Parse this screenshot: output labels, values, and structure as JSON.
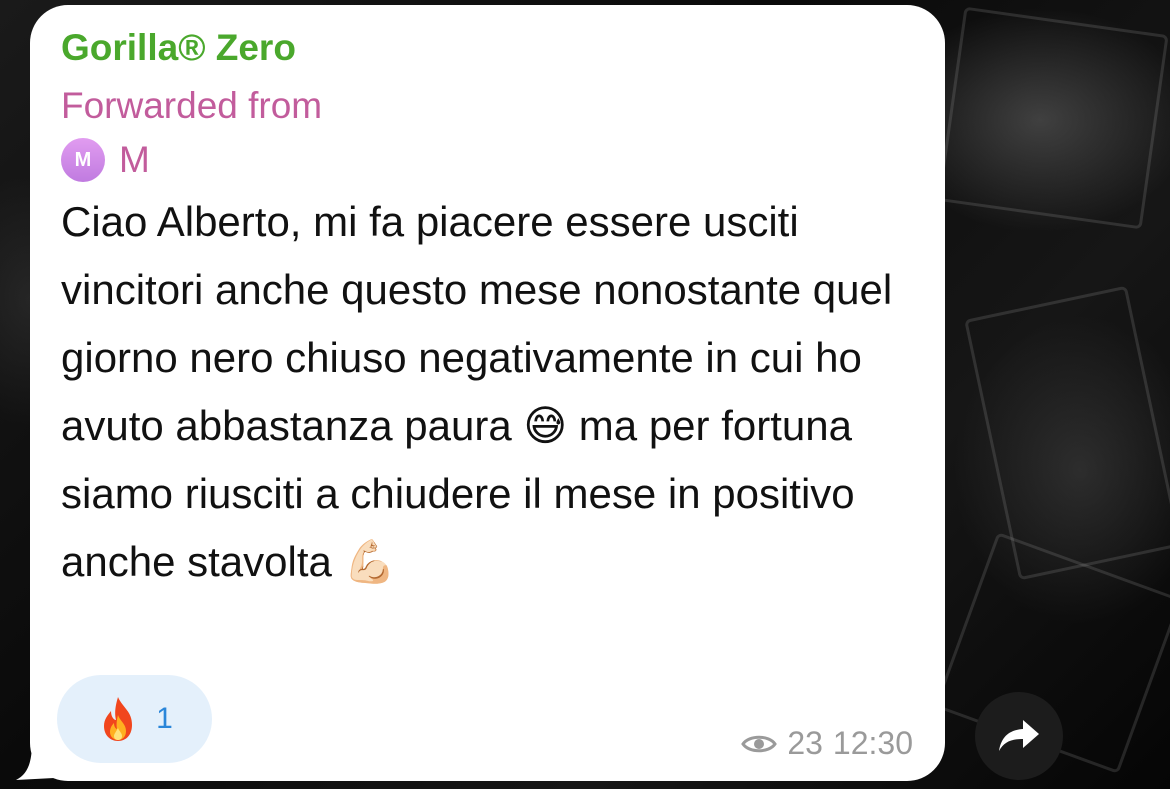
{
  "message": {
    "sender": "Gorilla® Zero",
    "forwarded_label": "Forwarded from",
    "forwarded_avatar_initial": "M",
    "forwarded_name": "M",
    "text": "Ciao Alberto, mi fa piacere essere usciti vincitori anche questo mese nonostante quel giorno nero chiuso negativamente in cui ho avuto abbastanza paura 😅 ma per fortuna siamo riusciti a chiudere il mese in positivo anche stavolta 💪🏻",
    "reaction": {
      "emoji": "🔥",
      "icon": "fire-icon",
      "count": "1"
    },
    "views": "23",
    "time": "12:30"
  },
  "icons": {
    "views": "eye-icon",
    "share": "share-arrow-icon"
  },
  "colors": {
    "sender": "#4aa82c",
    "forwarded": "#c25c9c",
    "reaction_bg": "#e4f0fb",
    "reaction_count": "#2a86d9",
    "meta": "#9a9a9a",
    "bubble": "#ffffff"
  }
}
